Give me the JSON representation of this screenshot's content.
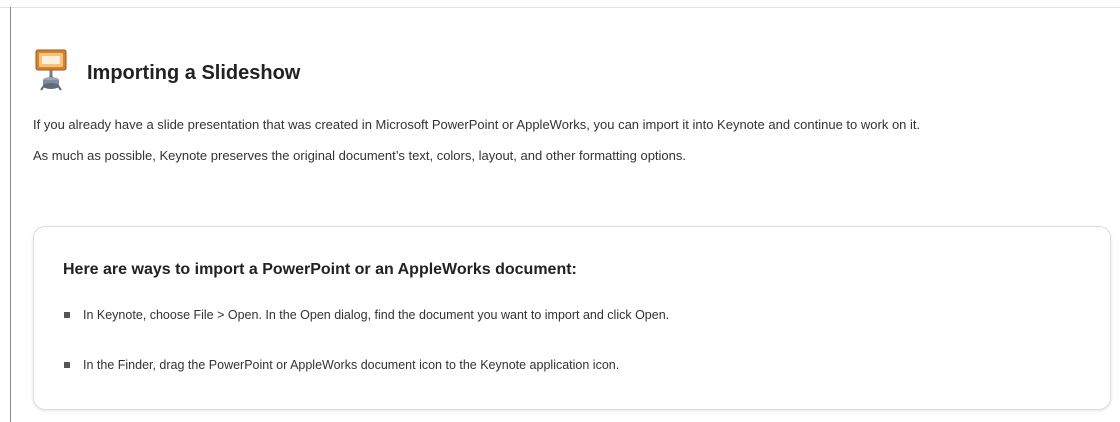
{
  "page": {
    "title": "Importing a Slideshow",
    "icon": "keynote-presentation-icon"
  },
  "intro": {
    "paragraph_1": "If you already have a slide presentation that was created in Microsoft PowerPoint or AppleWorks, you can import it into Keynote and continue to work on it.",
    "paragraph_2": "As much as possible, Keynote preserves the original document’s text, colors, layout, and other formatting options."
  },
  "tip_box": {
    "heading": "Here are ways to import a PowerPoint or an AppleWorks document:",
    "items": [
      {
        "text": "In Keynote, choose File > Open. In the Open dialog, find the document you want to import and click Open."
      },
      {
        "text": "In the Finder, drag the PowerPoint or AppleWorks document icon to the Keynote application icon."
      }
    ]
  },
  "colors": {
    "text": "#222222",
    "box_border": "#dedede",
    "icon_orange": "#d9822b"
  }
}
